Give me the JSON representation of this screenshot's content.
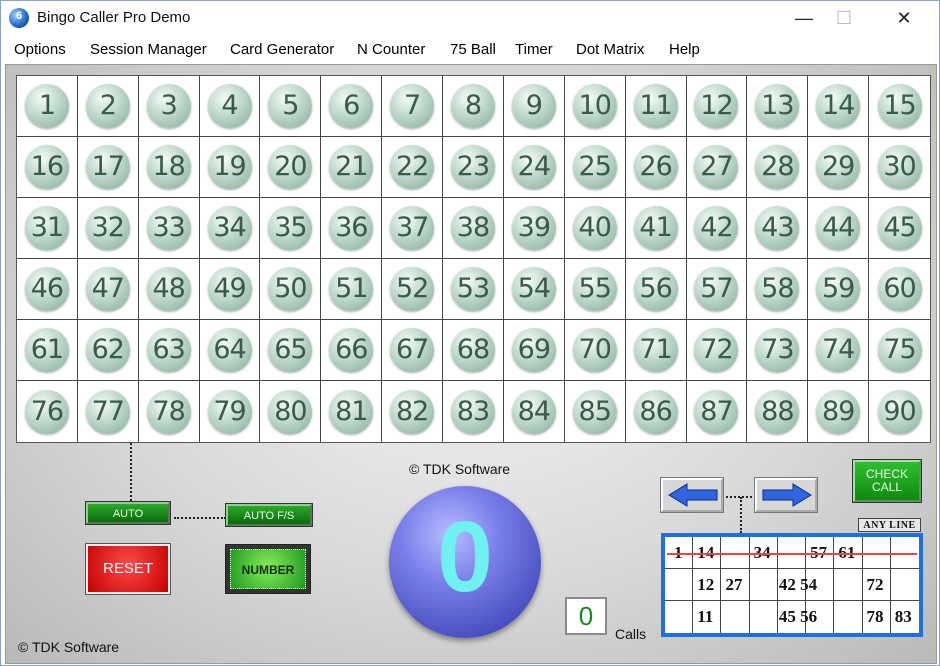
{
  "window": {
    "title": "Bingo Caller Pro Demo",
    "app_icon_glyph": "6",
    "controls": {
      "minimize": "—",
      "maximize": "☐",
      "close": "✕"
    }
  },
  "menu": [
    "Options",
    "Session Manager",
    "Card Generator",
    "N Counter",
    "75 Ball",
    "Timer",
    "Dot Matrix",
    "Help"
  ],
  "board": {
    "numbers": [
      1,
      2,
      3,
      4,
      5,
      6,
      7,
      8,
      9,
      10,
      11,
      12,
      13,
      14,
      15,
      16,
      17,
      18,
      19,
      20,
      21,
      22,
      23,
      24,
      25,
      26,
      27,
      28,
      29,
      30,
      31,
      32,
      33,
      34,
      35,
      36,
      37,
      38,
      39,
      40,
      41,
      42,
      43,
      44,
      45,
      46,
      47,
      48,
      49,
      50,
      51,
      52,
      53,
      54,
      55,
      56,
      57,
      58,
      59,
      60,
      61,
      62,
      63,
      64,
      65,
      66,
      67,
      68,
      69,
      70,
      71,
      72,
      73,
      74,
      75,
      76,
      77,
      78,
      79,
      80,
      81,
      82,
      83,
      84,
      85,
      86,
      87,
      88,
      89,
      90
    ]
  },
  "controls": {
    "auto_label": "AUTO",
    "auto_fs_label": "AUTO F/S",
    "reset_label": "RESET",
    "number_label": "NUMBER",
    "check_call_line1": "CHECK",
    "check_call_line2": "CALL",
    "any_line_label": "ANY LINE"
  },
  "copyright_center": "© TDK Software",
  "copyright_left": "© TDK Software",
  "current_ball": "0",
  "calls_count": "0",
  "calls_label": "Calls",
  "card": {
    "rows": [
      [
        "1",
        "14",
        "",
        "34",
        "",
        "57",
        "61",
        "",
        ""
      ],
      [
        "",
        "12",
        "27",
        "",
        "42 54",
        "",
        "",
        "72",
        ""
      ],
      [
        "",
        "11",
        "",
        "",
        "45 56",
        "",
        "",
        "78",
        "83"
      ]
    ]
  },
  "colors": {
    "accent_green": "#108a10",
    "reset_red": "#d40000",
    "ball_blue": "#5a60d4",
    "ball_digit_cyan": "#6ff1f1",
    "card_border_blue": "#1f6fe0",
    "strike_red": "#e84545"
  }
}
